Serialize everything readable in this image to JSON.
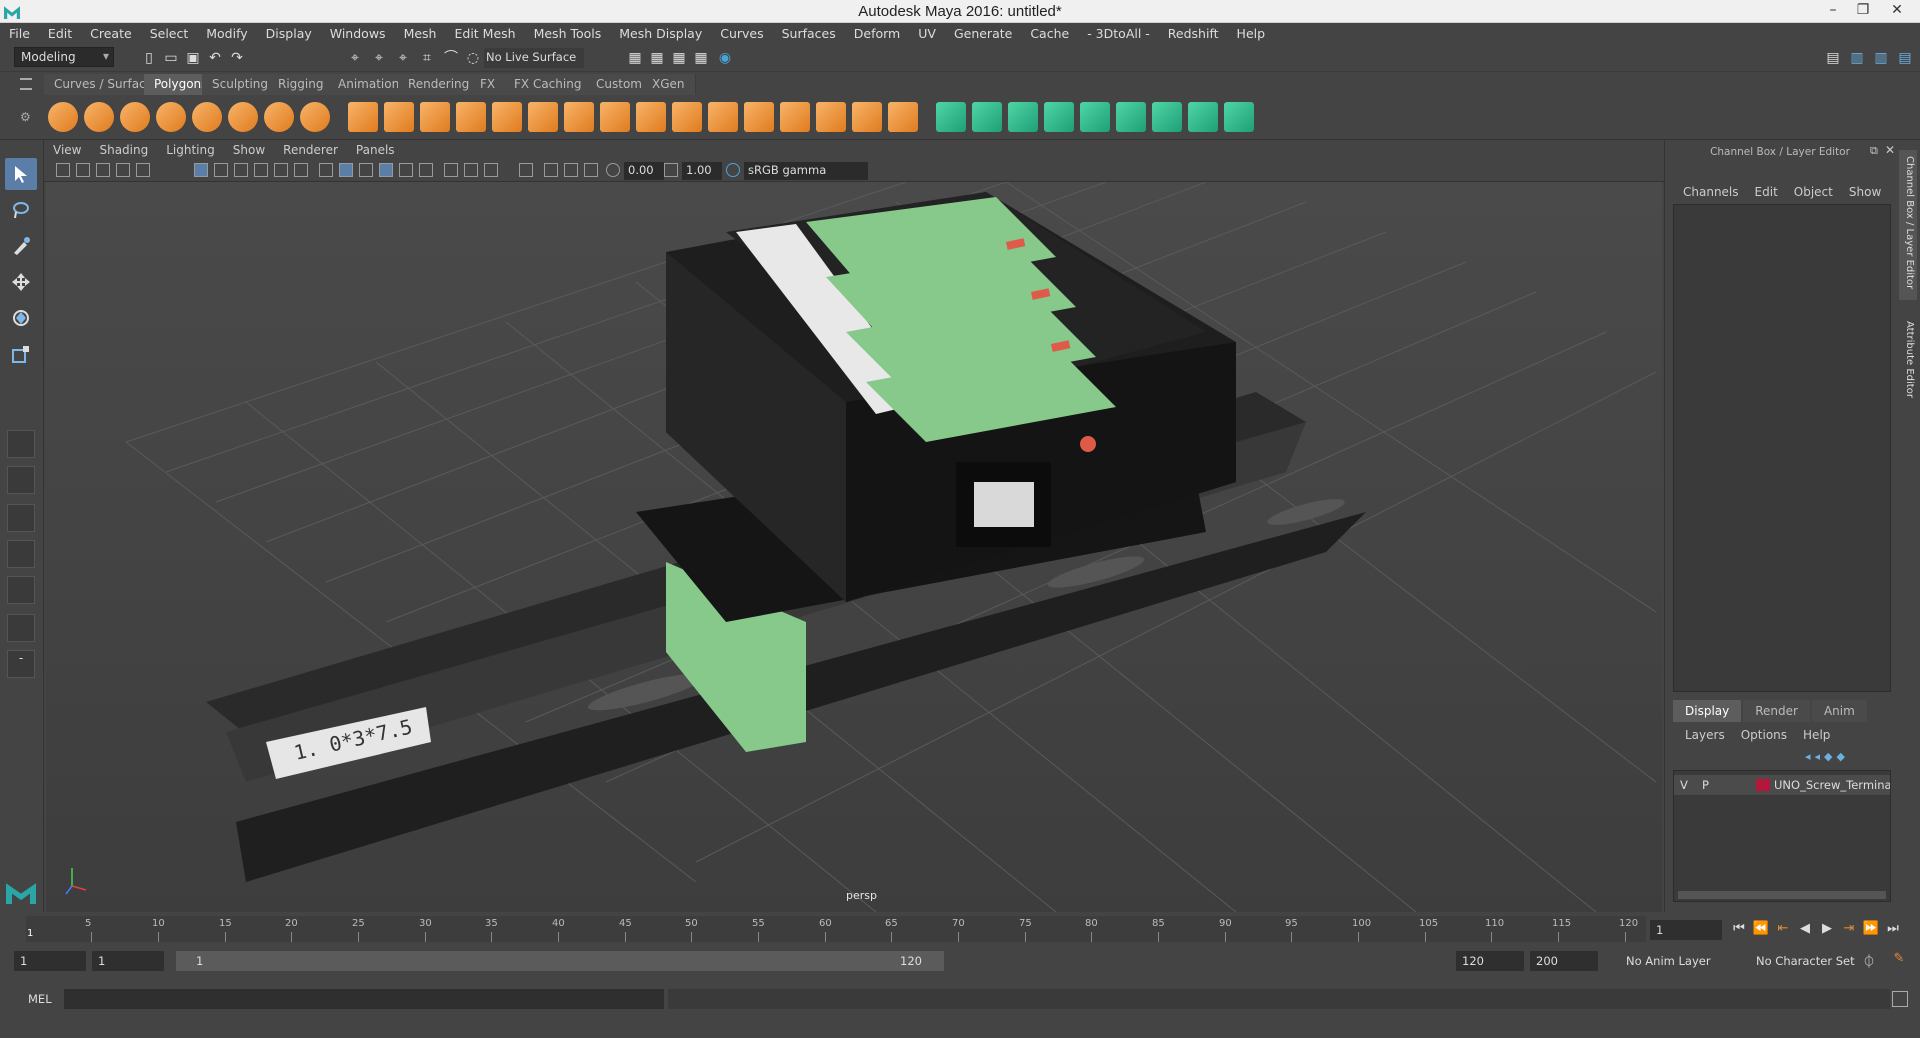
{
  "window": {
    "title": "Autodesk Maya 2016: untitled*"
  },
  "menus": [
    "File",
    "Edit",
    "Create",
    "Select",
    "Modify",
    "Display",
    "Windows",
    "Mesh",
    "Edit Mesh",
    "Mesh Tools",
    "Mesh Display",
    "Curves",
    "Surfaces",
    "Deform",
    "UV",
    "Generate",
    "Cache",
    "- 3DtoAll -",
    "Redshift",
    "Help"
  ],
  "status_line": {
    "mode": "Modeling",
    "live_surface": "No Live Surface"
  },
  "shelf_tabs": [
    {
      "label": "Curves / Surfaces",
      "active": false
    },
    {
      "label": "Polygons",
      "active": true
    },
    {
      "label": "Sculpting",
      "active": false
    },
    {
      "label": "Rigging",
      "active": false
    },
    {
      "label": "Animation",
      "active": false
    },
    {
      "label": "Rendering",
      "active": false
    },
    {
      "label": "FX",
      "active": false
    },
    {
      "label": "FX Caching",
      "active": false
    },
    {
      "label": "Custom",
      "active": false
    },
    {
      "label": "XGen",
      "active": false
    }
  ],
  "panel_menu": [
    "View",
    "Shading",
    "Lighting",
    "Show",
    "Renderer",
    "Panels"
  ],
  "panel_toolbar": {
    "exposure": "0.00",
    "gamma": "1.00",
    "color_space": "sRGB gamma"
  },
  "viewport": {
    "camera": "persp",
    "label_text": "1. 0*3*7.5",
    "colors": {
      "box": "#1e1e1e",
      "terminal": "#86c98a",
      "header": "#e8e8e8",
      "rail": "#2a2a2a",
      "accent": "#e05a4a"
    }
  },
  "channel_box": {
    "title": "Channel Box / Layer Editor",
    "menu": [
      "Channels",
      "Edit",
      "Object",
      "Show"
    ],
    "side_tabs": [
      "Channel Box / Layer Editor",
      "Attribute Editor"
    ]
  },
  "layer_editor": {
    "tabs": [
      {
        "label": "Display",
        "active": true
      },
      {
        "label": "Render",
        "active": false
      },
      {
        "label": "Anim",
        "active": false
      }
    ],
    "menu": [
      "Layers",
      "Options",
      "Help"
    ],
    "layers": [
      {
        "v": "V",
        "p": "P",
        "name": "UNO_Screw_Terminal_Blo",
        "color": "#b3173a"
      }
    ]
  },
  "time_slider": {
    "start": "1",
    "ticks": [
      "5",
      "10",
      "15",
      "20",
      "25",
      "30",
      "35",
      "40",
      "45",
      "50",
      "55",
      "60",
      "65",
      "70",
      "75",
      "80",
      "85",
      "90",
      "95",
      "100",
      "105",
      "110",
      "115",
      "120"
    ],
    "current_frame": "1"
  },
  "range_slider": {
    "start_frame": "1",
    "playback_start": "1",
    "range_start": "1",
    "range_end": "120",
    "playback_end": "120",
    "end_frame": "200",
    "anim_layer": "No Anim Layer",
    "character_set": "No Character Set"
  },
  "command_line": {
    "label": "MEL"
  }
}
